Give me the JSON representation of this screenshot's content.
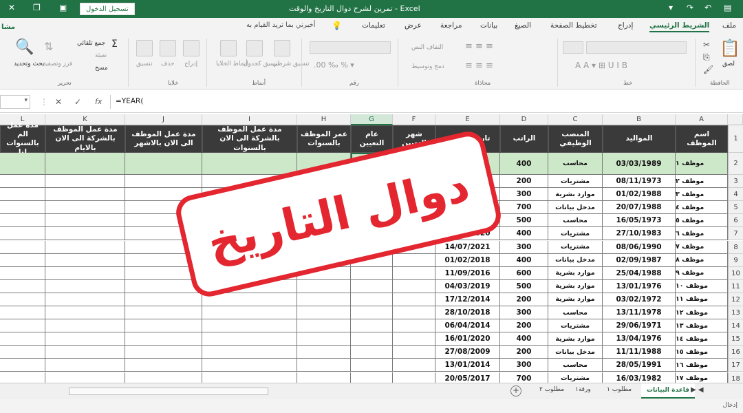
{
  "titlebar": {
    "title": "تمرين لشرح دوال التاريخ والوقت - Excel",
    "signin": "تسجيل الدخول"
  },
  "tabs": [
    {
      "label": "ملف"
    },
    {
      "label": "الشريط الرئيسي",
      "active": true
    },
    {
      "label": "إدراج"
    },
    {
      "label": "تخطيط الصفحة"
    },
    {
      "label": "الصيغ"
    },
    {
      "label": "بيانات"
    },
    {
      "label": "مراجعة"
    },
    {
      "label": "عرض"
    },
    {
      "label": "تعليمات"
    }
  ],
  "tellme": "أخبرني بما تريد القيام به",
  "ribbon": {
    "groups": [
      "الحافظة",
      "خط",
      "محاذاة",
      "رقم",
      "أنماط",
      "خلايا",
      "تحرير"
    ],
    "autosum": "جمع تلقائي",
    "fill": "تعبئة",
    "clear": "مسح",
    "sort": "فرز وتصفية",
    "find": "بحث وتحديد",
    "paste": "لصق",
    "mini_labels": [
      "التفاف النص",
      "دمج وتوسيط",
      "تنسيق شرطي",
      "تنسيق كجدول",
      "أنماط الخلايا",
      "إدراج",
      "حذف",
      "تنسيق"
    ],
    "share": "مشا"
  },
  "formula_bar": {
    "formula": "=YEAR("
  },
  "columns": [
    "A",
    "B",
    "C",
    "D",
    "E",
    "F",
    "G",
    "H",
    "I",
    "J",
    "K",
    "L"
  ],
  "headers": {
    "A": "اسم الموظف",
    "B": "المواليد",
    "C": "المنصب الوظيفي",
    "D": "الراتب",
    "E": "تاريخ التعيين",
    "F": "شهر التعيين",
    "G": "عام التعيين",
    "H": "عمر الموظف بالسنوات",
    "I": "مدة عمل الموظف بالشركة الى الان بالسنوات",
    "J": "مدة عمل الموظف الى الان بالاشهر",
    "K": "مدة عمل الموظف بالشركة الى الان بالايام",
    "L": "مدة عمل الم بالسنوات لتا"
  },
  "active_cell_text": "=YEAR(",
  "rows": [
    {
      "num": "2",
      "name": "موظف ١",
      "birth": "03/03/1989",
      "job": "محاسب",
      "salary": "400",
      "hire": ""
    },
    {
      "num": "3",
      "name": "موظف ٢",
      "birth": "08/11/1973",
      "job": "مشتريات",
      "salary": "200",
      "hire": ""
    },
    {
      "num": "4",
      "name": "موظف ٣",
      "birth": "01/02/1988",
      "job": "موارد بشرية",
      "salary": "300",
      "hire": ""
    },
    {
      "num": "5",
      "name": "موظف ٤",
      "birth": "20/07/1988",
      "job": "مدخل بيانات",
      "salary": "700",
      "hire": ""
    },
    {
      "num": "6",
      "name": "موظف ٥",
      "birth": "16/05/1973",
      "job": "محاسب",
      "salary": "500",
      "hire": ""
    },
    {
      "num": "7",
      "name": "موظف ٦",
      "birth": "27/10/1983",
      "job": "مشتريات",
      "salary": "400",
      "hire": "11/09/2020"
    },
    {
      "num": "8",
      "name": "موظف ٧",
      "birth": "08/06/1990",
      "job": "مشتريات",
      "salary": "300",
      "hire": "14/07/2021"
    },
    {
      "num": "9",
      "name": "موظف ٨",
      "birth": "02/09/1987",
      "job": "مدخل بيانات",
      "salary": "400",
      "hire": "01/02/2018"
    },
    {
      "num": "10",
      "name": "موظف ٩",
      "birth": "25/04/1988",
      "job": "موارد بشرية",
      "salary": "600",
      "hire": "11/09/2016"
    },
    {
      "num": "11",
      "name": "موظف ١٠",
      "birth": "13/01/1976",
      "job": "موارد بشرية",
      "salary": "500",
      "hire": "04/03/2019"
    },
    {
      "num": "12",
      "name": "موظف ١١",
      "birth": "03/02/1972",
      "job": "موارد بشرية",
      "salary": "200",
      "hire": "17/12/2014"
    },
    {
      "num": "13",
      "name": "موظف ١٢",
      "birth": "13/11/1978",
      "job": "محاسب",
      "salary": "300",
      "hire": "28/10/2018"
    },
    {
      "num": "14",
      "name": "موظف ١٣",
      "birth": "29/06/1971",
      "job": "مشتريات",
      "salary": "200",
      "hire": "06/04/2014"
    },
    {
      "num": "15",
      "name": "موظف ١٤",
      "birth": "13/04/1976",
      "job": "موارد بشرية",
      "salary": "400",
      "hire": "16/01/2020"
    },
    {
      "num": "16",
      "name": "موظف ١٥",
      "birth": "11/11/1988",
      "job": "مدخل بيانات",
      "salary": "200",
      "hire": "27/08/2009"
    },
    {
      "num": "17",
      "name": "موظف ١٦",
      "birth": "28/05/1991",
      "job": "محاسب",
      "salary": "300",
      "hire": "13/01/2014"
    },
    {
      "num": "18",
      "name": "موظف ١٧",
      "birth": "16/03/1982",
      "job": "مشتريات",
      "salary": "700",
      "hire": "20/05/2017"
    }
  ],
  "stamp": "دوال التاريخ",
  "sheet_tabs": [
    {
      "label": "قاعدة البيانات",
      "active": true
    },
    {
      "label": "مطلوب ١"
    },
    {
      "label": "ورقة١"
    },
    {
      "label": "مطلوب ٢"
    }
  ],
  "status": "إدخال"
}
